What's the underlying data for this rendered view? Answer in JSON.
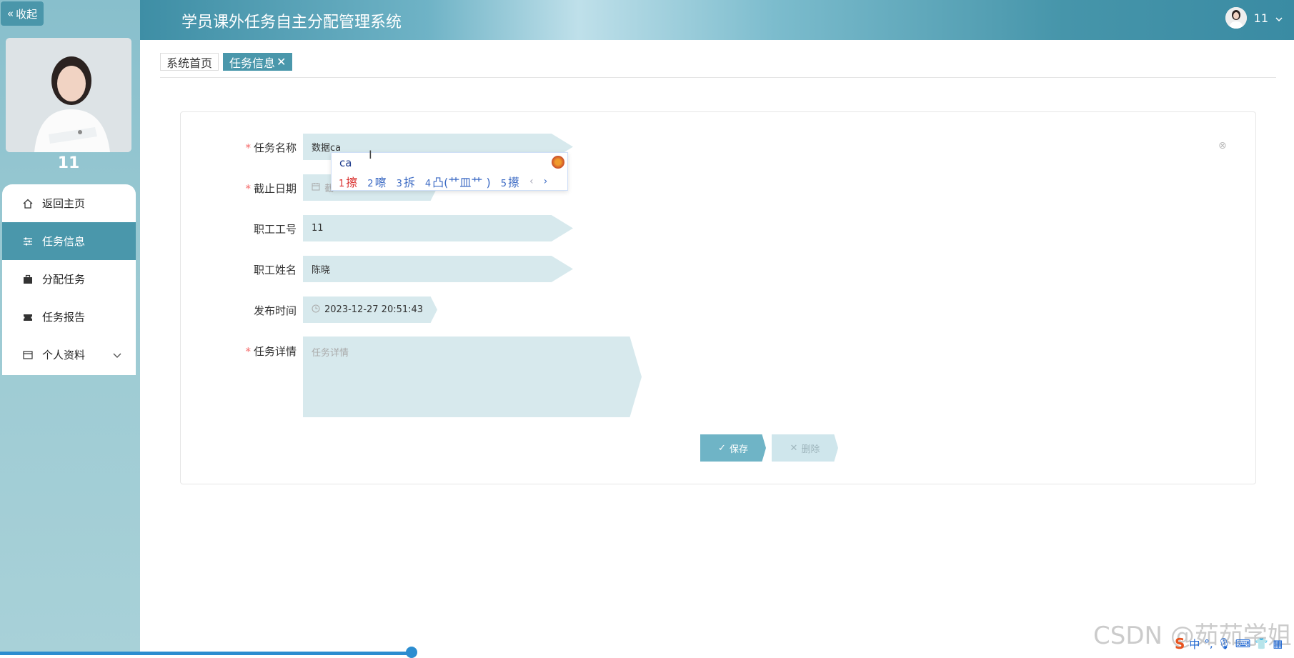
{
  "sidebar": {
    "collapse_label": "收起",
    "username": "11",
    "items": [
      {
        "label": "返回主页",
        "icon": "home-icon"
      },
      {
        "label": "任务信息",
        "icon": "sliders-icon",
        "active": true
      },
      {
        "label": "分配任务",
        "icon": "briefcase-icon"
      },
      {
        "label": "任务报告",
        "icon": "ticket-icon"
      },
      {
        "label": "个人资料",
        "icon": "wallet-icon",
        "has_children": true
      }
    ]
  },
  "header": {
    "title": "学员课外任务自主分配管理系统",
    "user": "11"
  },
  "tabs": [
    {
      "label": "系统首页",
      "active": false
    },
    {
      "label": "任务信息",
      "active": true
    }
  ],
  "form": {
    "task_name_label": "任务名称",
    "task_name_value": "数据ca",
    "deadline_label": "截止日期",
    "deadline_placeholder": "截",
    "staff_id_label": "职工工号",
    "staff_id_value": "11",
    "staff_name_label": "职工姓名",
    "staff_name_value": "陈晓",
    "publish_time_label": "发布时间",
    "publish_time_value": "2023-12-27 20:51:43",
    "detail_label": "任务详情",
    "detail_placeholder": "任务详情",
    "save_label": "保存",
    "delete_label": "删除"
  },
  "ime": {
    "input": "ca",
    "candidates": [
      {
        "n": "1",
        "text": "擦"
      },
      {
        "n": "2",
        "text": "嚓"
      },
      {
        "n": "3",
        "text": "拆"
      },
      {
        "n": "4",
        "text": "凸(艹皿艹 )"
      },
      {
        "n": "5",
        "text": "攃"
      }
    ]
  },
  "watermark": "CSDN @茹茹学姐",
  "tray": {
    "lang": "中"
  },
  "colors": {
    "accent": "#4a97ab",
    "field_bg": "#d7e9ed",
    "required": "#f56c6c"
  }
}
